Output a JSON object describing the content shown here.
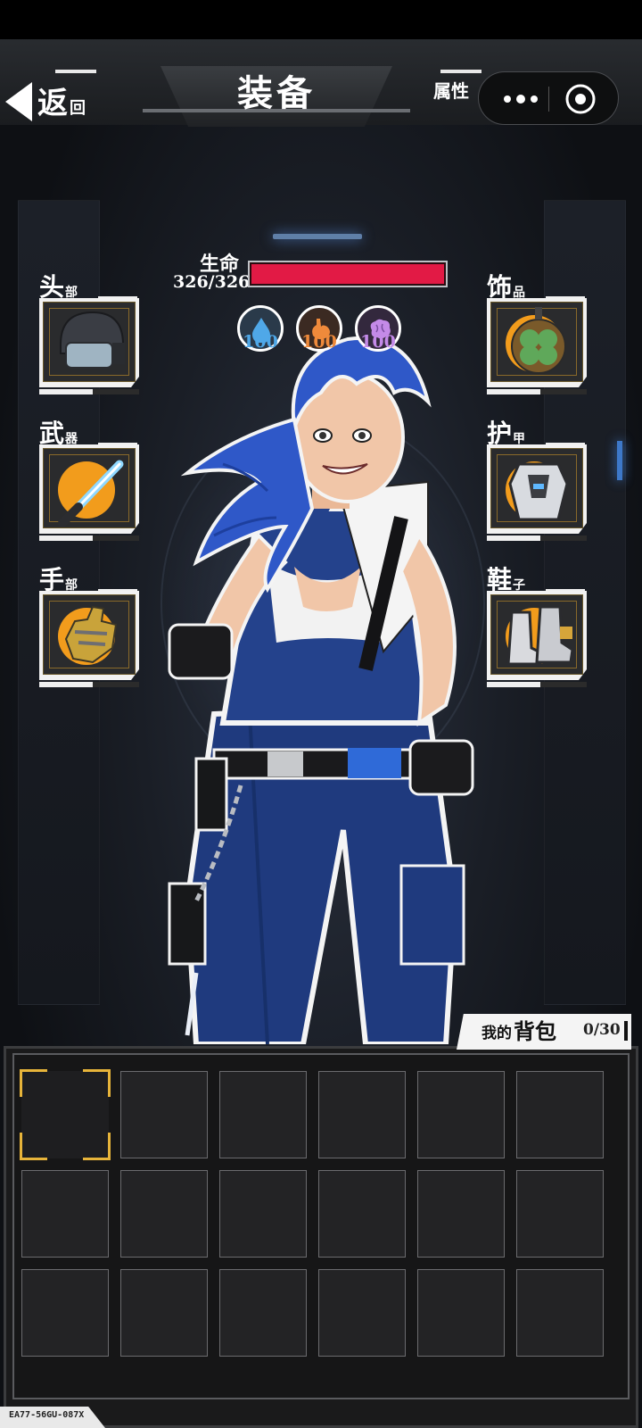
{
  "header": {
    "back_label_big": "返",
    "back_label_small": "回",
    "title": "装备",
    "attributes_tab": "属性"
  },
  "hp": {
    "label": "生命",
    "value": "326/326",
    "fraction": 1.0,
    "color": "#e21a45"
  },
  "stats": [
    {
      "name": "water",
      "icon": "water-drop-icon",
      "value": "100",
      "color": "#4fa8e8"
    },
    {
      "name": "food",
      "icon": "stomach-icon",
      "value": "100",
      "color": "#ef8a3b"
    },
    {
      "name": "mind",
      "icon": "brain-icon",
      "value": "100",
      "color": "#c48ae8"
    }
  ],
  "slots": {
    "head": {
      "big": "头",
      "small": "部",
      "item_icon": "helmet-icon"
    },
    "weapon": {
      "big": "武",
      "small": "器",
      "item_icon": "lightsaber-icon"
    },
    "hands": {
      "big": "手",
      "small": "部",
      "item_icon": "gauntlet-icon"
    },
    "accessory": {
      "big": "饰",
      "small": "品",
      "item_icon": "clover-charm-icon"
    },
    "armor": {
      "big": "护",
      "small": "甲",
      "item_icon": "armor-vest-icon"
    },
    "shoes": {
      "big": "鞋",
      "small": "子",
      "item_icon": "boots-icon"
    }
  },
  "backpack": {
    "title_small": "我的",
    "title_big": "背包",
    "count": "0/30",
    "rows": 3,
    "cols": 6,
    "selected_index": 0
  },
  "footer_code": "EA77-56GU-087X",
  "colors": {
    "accent_gold": "#e7b43a",
    "orb_orange": "#f29c1c",
    "hair_blue": "#2f58c8"
  }
}
